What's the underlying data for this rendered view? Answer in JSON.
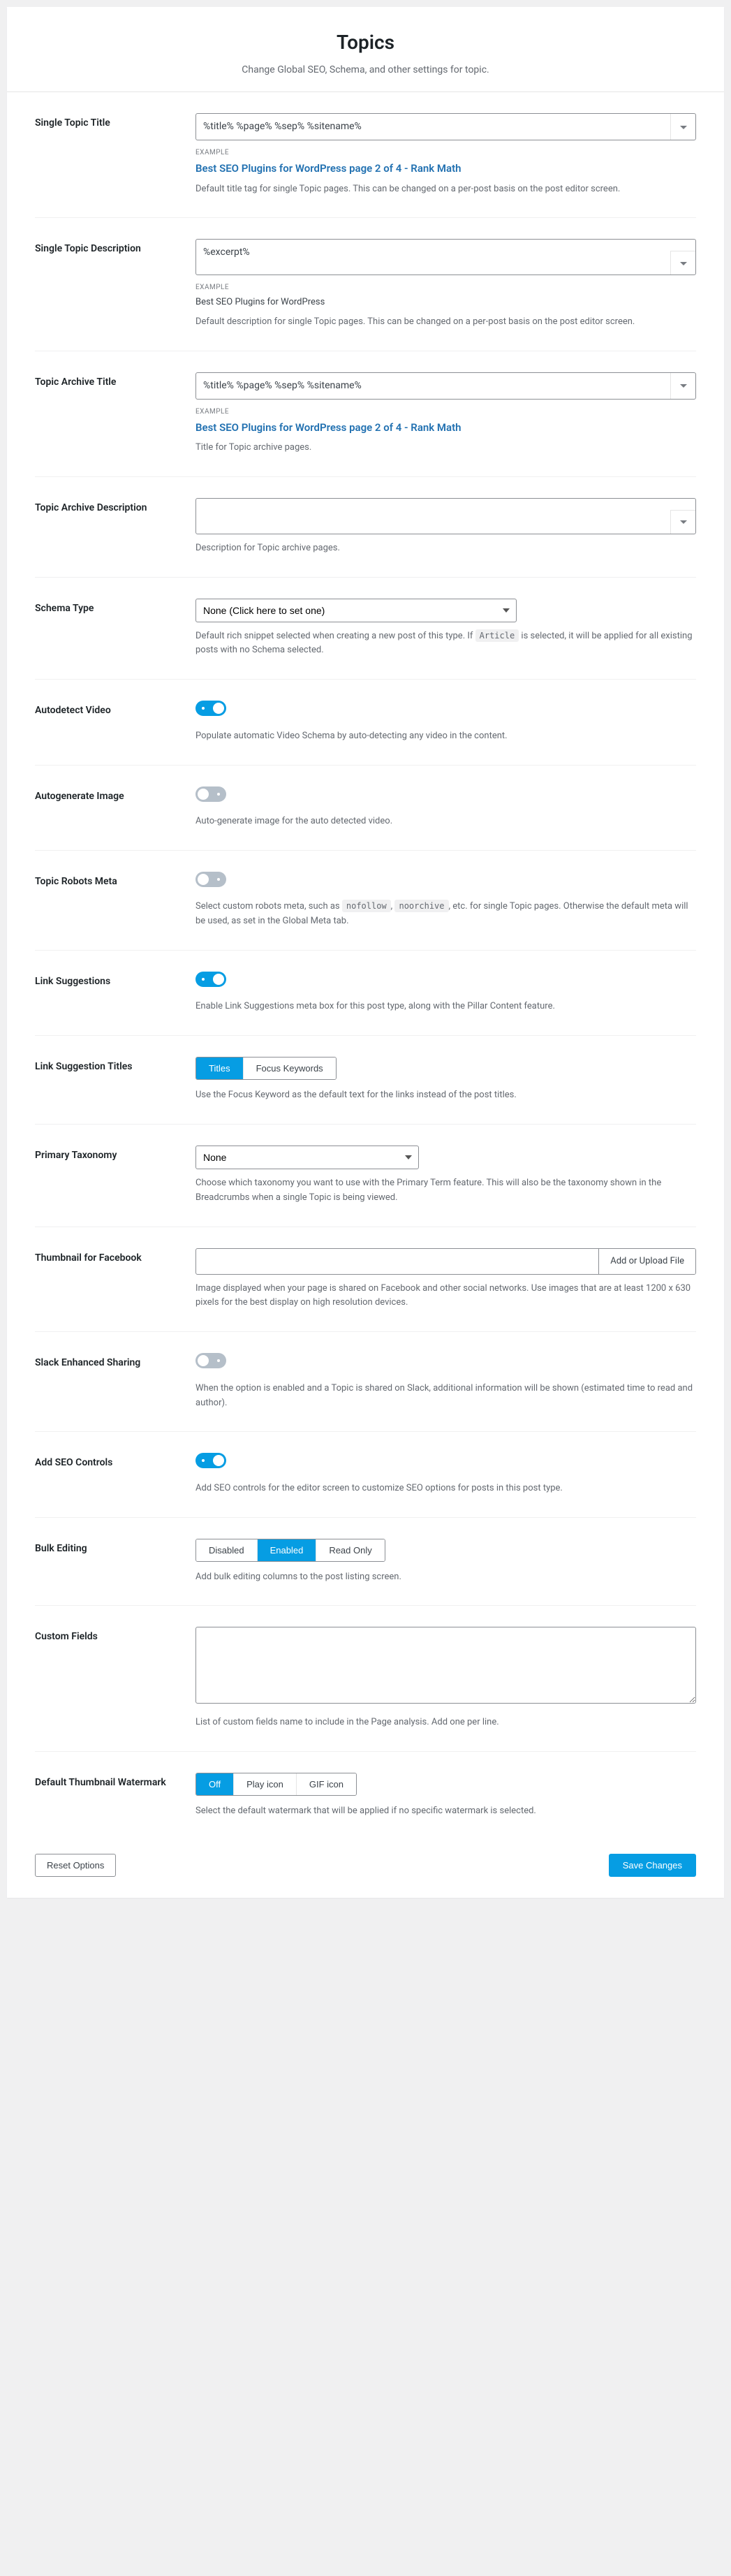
{
  "header": {
    "title": "Topics",
    "subtitle": "Change Global SEO, Schema, and other settings for topic."
  },
  "rows": {
    "single_title": {
      "label": "Single Topic Title",
      "value": "%title% %page% %sep% %sitename%",
      "example_label": "EXAMPLE",
      "example": "Best SEO Plugins for WordPress page 2 of 4 - Rank Math",
      "desc": "Default title tag for single Topic pages. This can be changed on a per-post basis on the post editor screen."
    },
    "single_desc": {
      "label": "Single Topic Description",
      "value": "%excerpt%",
      "example_label": "EXAMPLE",
      "example": "Best SEO Plugins for WordPress",
      "desc": "Default description for single Topic pages. This can be changed on a per-post basis on the post editor screen."
    },
    "archive_title": {
      "label": "Topic Archive Title",
      "value": "%title% %page% %sep% %sitename%",
      "example_label": "EXAMPLE",
      "example": "Best SEO Plugins for WordPress page 2 of 4 - Rank Math",
      "desc": "Title for Topic archive pages."
    },
    "archive_desc": {
      "label": "Topic Archive Description",
      "value": "",
      "desc": "Description for Topic archive pages."
    },
    "schema": {
      "label": "Schema Type",
      "value": "None (Click here to set one)",
      "desc_pre": "Default rich snippet selected when creating a new post of this type. If ",
      "desc_code": "Article",
      "desc_post": " is selected, it will be applied for all existing posts with no Schema selected."
    },
    "autodetect_video": {
      "label": "Autodetect Video",
      "desc": "Populate automatic Video Schema by auto-detecting any video in the content."
    },
    "autogenerate_image": {
      "label": "Autogenerate Image",
      "desc": "Auto-generate image for the auto detected video."
    },
    "robots": {
      "label": "Topic Robots Meta",
      "desc_pre": "Select custom robots meta, such as ",
      "code1": "nofollow",
      "sep": ", ",
      "code2": "noorchive",
      "desc_post": ", etc. for single Topic pages. Otherwise the default meta will be used, as set in the Global Meta tab."
    },
    "link_suggestions": {
      "label": "Link Suggestions",
      "desc": "Enable Link Suggestions meta box for this post type, along with the Pillar Content feature."
    },
    "link_titles": {
      "label": "Link Suggestion Titles",
      "opt1": "Titles",
      "opt2": "Focus Keywords",
      "desc": "Use the Focus Keyword as the default text for the links instead of the post titles."
    },
    "primary_tax": {
      "label": "Primary Taxonomy",
      "value": "None",
      "desc": "Choose which taxonomy you want to use with the Primary Term feature. This will also be the taxonomy shown in the Breadcrumbs when a single Topic is being viewed."
    },
    "fb_thumb": {
      "label": "Thumbnail for Facebook",
      "btn": "Add or Upload File",
      "desc": "Image displayed when your page is shared on Facebook and other social networks. Use images that are at least 1200 x 630 pixels for the best display on high resolution devices."
    },
    "slack": {
      "label": "Slack Enhanced Sharing",
      "desc": "When the option is enabled and a Topic is shared on Slack, additional information will be shown (estimated time to read and author)."
    },
    "seo_controls": {
      "label": "Add SEO Controls",
      "desc": "Add SEO controls for the editor screen to customize SEO options for posts in this post type."
    },
    "bulk_edit": {
      "label": "Bulk Editing",
      "opt1": "Disabled",
      "opt2": "Enabled",
      "opt3": "Read Only",
      "desc": "Add bulk editing columns to the post listing screen."
    },
    "custom_fields": {
      "label": "Custom Fields",
      "desc": "List of custom fields name to include in the Page analysis. Add one per line."
    },
    "watermark": {
      "label": "Default Thumbnail Watermark",
      "opt1": "Off",
      "opt2": "Play icon",
      "opt3": "GIF icon",
      "desc": "Select the default watermark that will be applied if no specific watermark is selected."
    }
  },
  "footer": {
    "reset": "Reset Options",
    "save": "Save Changes"
  }
}
